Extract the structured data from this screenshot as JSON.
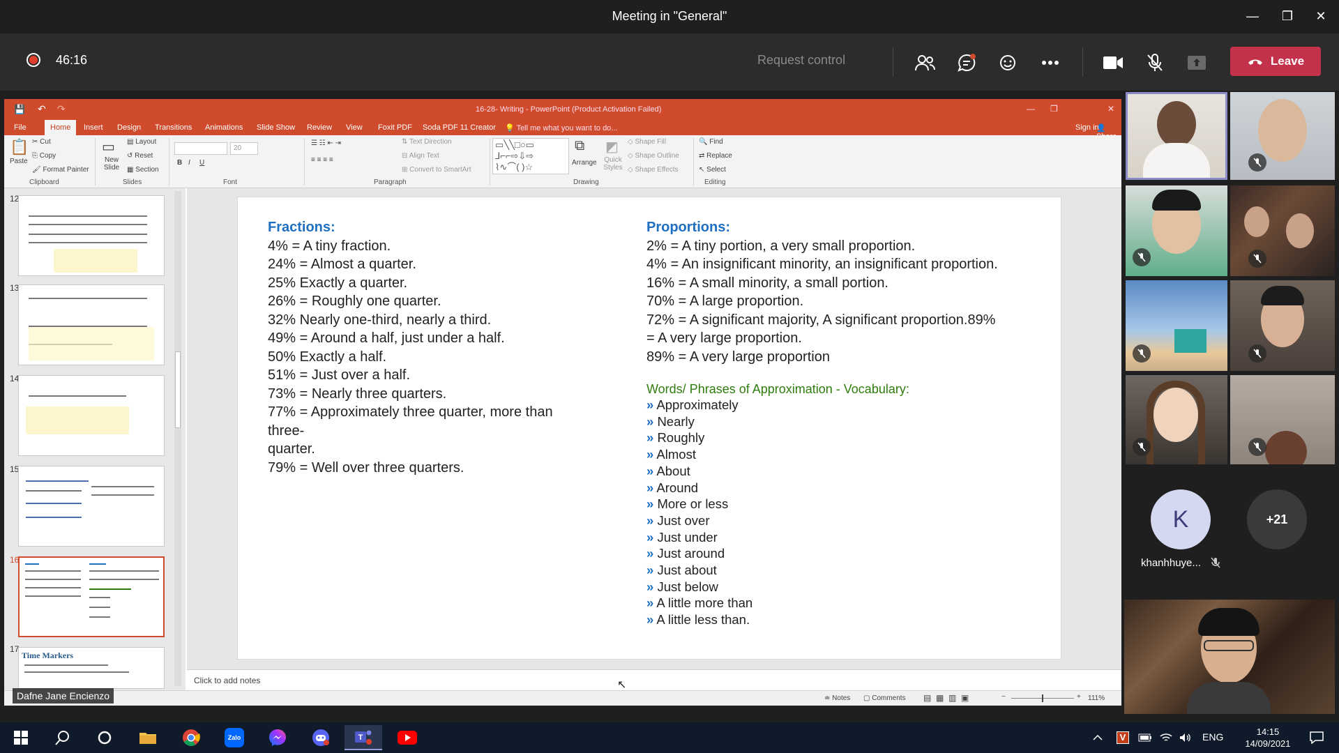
{
  "window": {
    "title": "Meeting in \"General\"",
    "minimize": "—",
    "restore": "❐",
    "close": "✕"
  },
  "call": {
    "elapsed": "46:16",
    "request_control": "Request control",
    "leave_label": "Leave"
  },
  "ppt": {
    "doc_title": "16-28- Writing - PowerPoint (Product Activation Failed)",
    "tabs": [
      "File",
      "Home",
      "Insert",
      "Design",
      "Transitions",
      "Animations",
      "Slide Show",
      "Review",
      "View",
      "Foxit PDF",
      "Soda PDF 11 Creator"
    ],
    "tell_me": "Tell me what you want to do...",
    "sign_in": "Sign in",
    "share": "Share",
    "ribbon": {
      "paste": "Paste",
      "cut": "Cut",
      "copy": "Copy",
      "format_painter": "Format Painter",
      "new_slide": "New Slide",
      "layout": "Layout",
      "reset": "Reset",
      "section": "Section",
      "font_size": "20",
      "text_direction": "Text Direction",
      "align_text": "Align Text",
      "convert_smartart": "Convert to SmartArt",
      "arrange": "Arrange",
      "quick_styles": "Quick Styles",
      "shape_fill": "Shape Fill",
      "shape_outline": "Shape Outline",
      "shape_effects": "Shape Effects",
      "find": "Find",
      "replace": "Replace",
      "select": "Select",
      "groups": {
        "clipboard": "Clipboard",
        "slides": "Slides",
        "font": "Font",
        "paragraph": "Paragraph",
        "drawing": "Drawing",
        "editing": "Editing"
      }
    },
    "thumbs": [
      {
        "num": "12"
      },
      {
        "num": "13"
      },
      {
        "num": "14"
      },
      {
        "num": "15"
      },
      {
        "num": "16"
      },
      {
        "num": "17",
        "title": "Time Markers"
      }
    ],
    "notes_placeholder": "Click to add notes",
    "status": {
      "notes": "Notes",
      "comments": "Comments",
      "zoom": "111%"
    }
  },
  "slide": {
    "fractions_header": "Fractions:",
    "fractions": [
      "4% = A tiny fraction.",
      "24% = Almost a quarter.",
      "25% Exactly a quarter.",
      "26% = Roughly one quarter.",
      "32% Nearly one-third, nearly a third.",
      "49% = Around a half, just under a half.",
      "50% Exactly a half.",
      "51% = Just over a half.",
      "73% = Nearly three quarters.",
      "77% = Approximately three quarter, more than three-",
      "quarter.",
      "79% = Well over three quarters."
    ],
    "proportions_header": "Proportions:",
    "proportions": [
      "2% = A tiny portion, a very small proportion.",
      "4% = An insignificant minority, an insignificant proportion.",
      "16% = A small minority, a small portion.",
      "70% = A large proportion.",
      "72% = A significant majority, A significant proportion.89%",
      "= A very large proportion.",
      "89% = A very large proportion"
    ],
    "vocab_header": "Words/ Phrases of Approximation - Vocabulary:",
    "bullet": "»",
    "vocab": [
      "Approximately",
      "Nearly",
      "Roughly",
      "Almost",
      "About",
      "Around",
      "More or less",
      "Just over",
      "Just under",
      "Just around",
      "Just about",
      "Just below",
      "A little more than",
      "A little less than."
    ]
  },
  "participants": {
    "speaker_name": "Dafne Jane Encienzo",
    "k_initial": "K",
    "k_name": "khanhhuye...",
    "more_count": "+21"
  },
  "taskbar": {
    "time": "14:15",
    "date": "14/09/2021",
    "lang": "ENG"
  }
}
